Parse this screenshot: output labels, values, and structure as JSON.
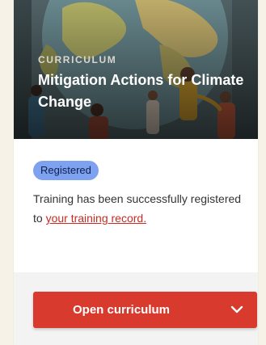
{
  "card": {
    "eyebrow": "CURRICULUM",
    "title": "Mitigation Actions for Climate Change",
    "badge": "Registered",
    "message_prefix": "Training has been successfully registered to ",
    "message_link": "your training record.",
    "cta_label": "Open curriculum",
    "cta_icon": "chevron-down-icon"
  },
  "colors": {
    "badge_bg": "#7ea2ef",
    "link": "#c92a23",
    "cta_bg": "#d83a2e"
  }
}
